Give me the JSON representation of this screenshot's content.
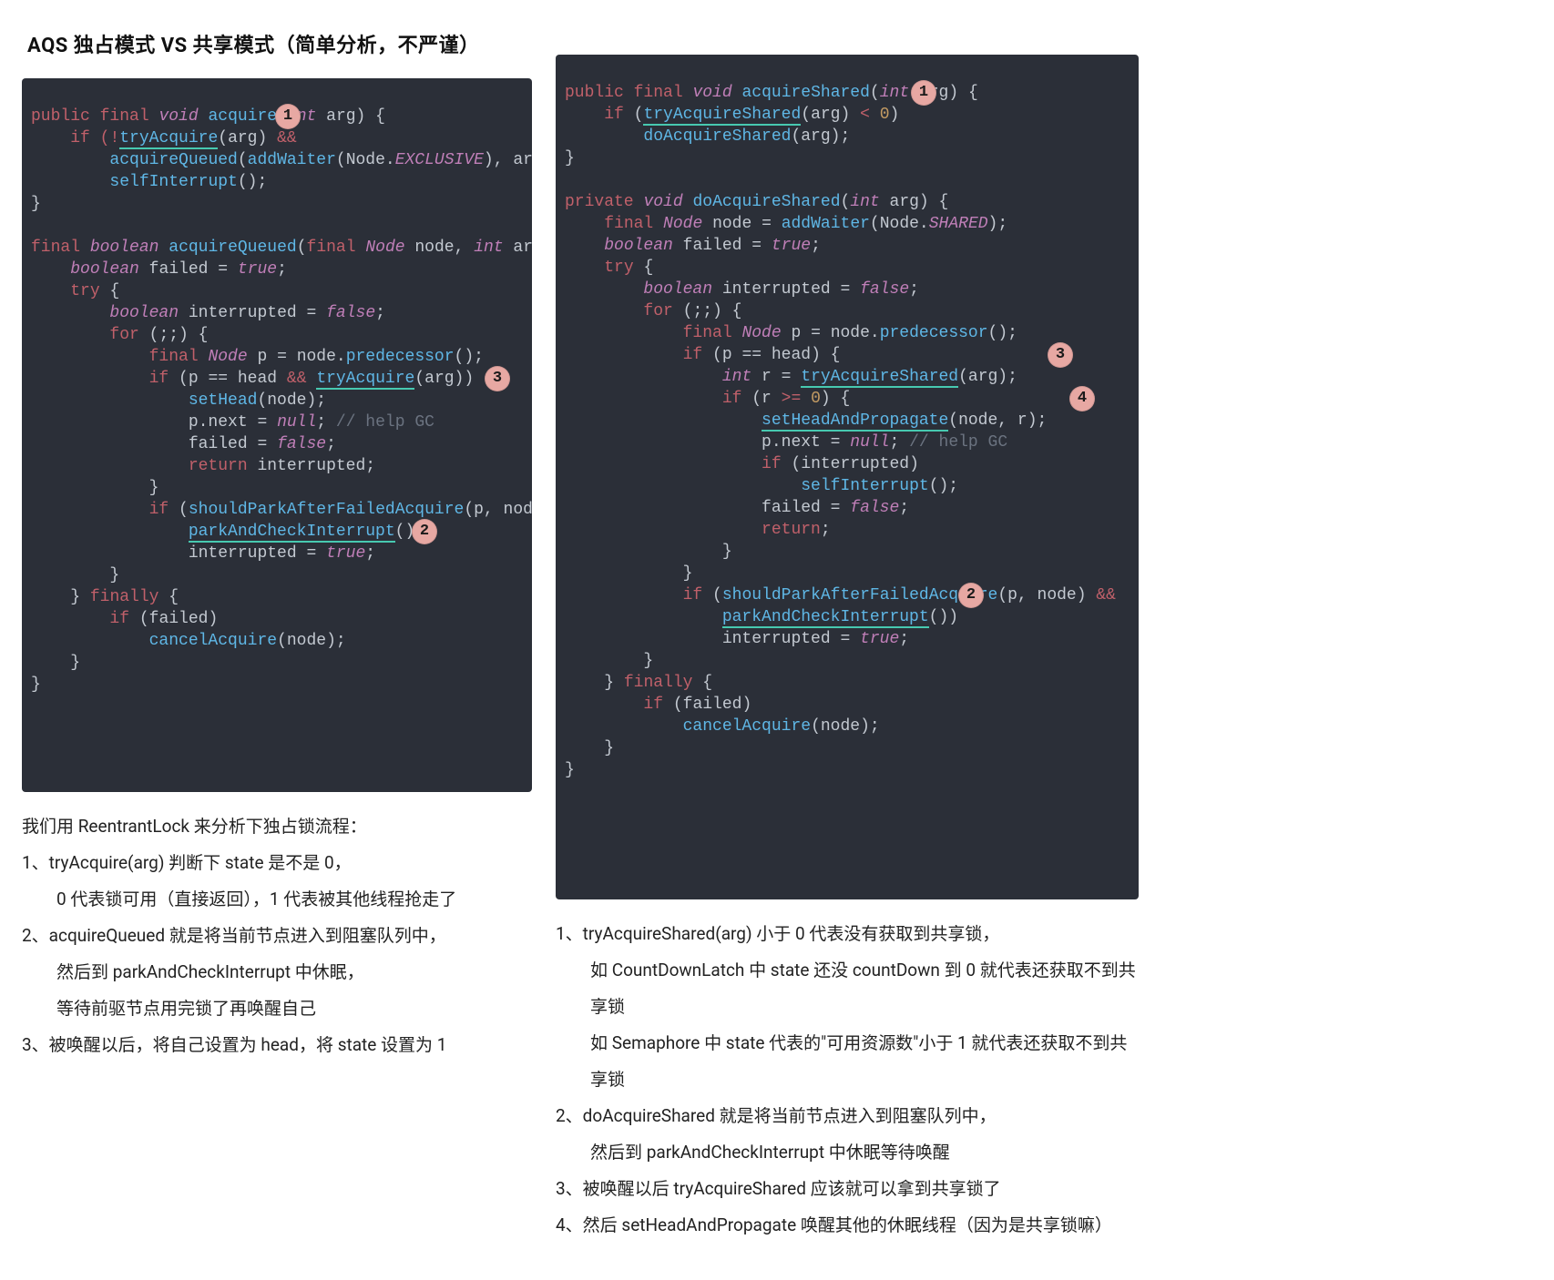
{
  "title": "AQS 独占模式 VS 共享模式（简单分析，不严谨）",
  "left": {
    "code": {
      "l01a": "public",
      "l01b": "final",
      "l01c": "void",
      "l01d": "acquire",
      "l01e": "int",
      "l01f": "arg",
      "l01g": ") {",
      "l02a": "if",
      "l02b": "(!",
      "l02c": "tryAcquire",
      "l02d": "(arg)",
      "l02e": "&&",
      "l03a": "acquireQueued",
      "l03b": "(",
      "l03c": "addWaiter",
      "l03d": "(Node.",
      "l03e": "EXCLUSIVE",
      "l03f": "), arg))",
      "l04a": "selfInterrupt",
      "l04b": "();",
      "l05a": "}",
      "l07a": "final",
      "l07b": "boolean",
      "l07c": "acquireQueued",
      "l07d": "(",
      "l07e": "final",
      "l07f": "Node",
      "l07g": "node,",
      "l07h": "int",
      "l07i": "arg) {",
      "l08a": "boolean",
      "l08b": "failed =",
      "l08c": "true",
      "l08d": ";",
      "l09a": "try",
      "l09b": "{",
      "l10a": "boolean",
      "l10b": "interrupted =",
      "l10c": "false",
      "l10d": ";",
      "l11a": "for",
      "l11b": "(;;) {",
      "l12a": "final",
      "l12b": "Node",
      "l12c": "p = node.",
      "l12d": "predecessor",
      "l12e": "();",
      "l13a": "if",
      "l13b": "(p == head",
      "l13c": "&&",
      "l13d": "tryAcquire",
      "l13e": "(arg)) {",
      "l14a": "setHead",
      "l14b": "(node);",
      "l15a": "p.next =",
      "l15b": "null",
      "l15c": ";",
      "l15d": "// help GC",
      "l16a": "failed =",
      "l16b": "false",
      "l16c": ";",
      "l17a": "return",
      "l17b": "interrupted;",
      "l18a": "}",
      "l19a": "if",
      "l19b": "(",
      "l19c": "shouldParkAfterFailedAcquire",
      "l19d": "(p, node)",
      "l19e": "&&",
      "l20a": "parkAndCheckInterrupt",
      "l20b": "())",
      "l21a": "interrupted =",
      "l21b": "true",
      "l21c": ";",
      "l22a": "}",
      "l23a": "}",
      "l23b": "finally",
      "l23c": "{",
      "l24a": "if",
      "l24b": "(failed)",
      "l25a": "cancelAcquire",
      "l25b": "(node);",
      "l26a": "}",
      "l27a": "}"
    },
    "badges": {
      "b1": "1",
      "b2": "2",
      "b3": "3"
    },
    "notes": [
      "我们用 ReentrantLock  来分析下独占锁流程：",
      "1、tryAcquire(arg) 判断下 state 是不是 0，",
      "0 代表锁可用（直接返回），1 代表被其他线程抢走了",
      "2、acquireQueued 就是将当前节点进入到阻塞队列中，",
      "然后到 parkAndCheckInterrupt 中休眠，",
      "等待前驱节点用完锁了再唤醒自己",
      "3、被唤醒以后，将自己设置为 head，将 state 设置为 1"
    ]
  },
  "right": {
    "code": {
      "l01a": "public",
      "l01b": "final",
      "l01c": "void",
      "l01d": "acquireShared",
      "l01e": "int",
      "l01f": "arg) {",
      "l02a": "if",
      "l02b": "(",
      "l02c": "tryAcquireShared",
      "l02d": "(arg)",
      "l02e": "<",
      "l02f": "0",
      "l02g": ")",
      "l03a": "doAcquireShared",
      "l03b": "(arg);",
      "l04a": "}",
      "l06a": "private",
      "l06b": "void",
      "l06c": "doAcquireShared",
      "l06d": "int",
      "l06e": "arg) {",
      "l07a": "final",
      "l07b": "Node",
      "l07c": "node =",
      "l07d": "addWaiter",
      "l07e": "(Node.",
      "l07f": "SHARED",
      "l07g": ");",
      "l08a": "boolean",
      "l08b": "failed =",
      "l08c": "true",
      "l08d": ";",
      "l09a": "try",
      "l09b": "{",
      "l10a": "boolean",
      "l10b": "interrupted =",
      "l10c": "false",
      "l10d": ";",
      "l11a": "for",
      "l11b": "(;;) {",
      "l12a": "final",
      "l12b": "Node",
      "l12c": "p = node.",
      "l12d": "predecessor",
      "l12e": "();",
      "l13a": "if",
      "l13b": "(p == head) {",
      "l14a": "int",
      "l14b": "r =",
      "l14c": "tryAcquireShared",
      "l14d": "(arg);",
      "l15a": "if",
      "l15b": "(r",
      "l15c": ">=",
      "l15d": "0",
      "l15e": ") {",
      "l16a": "setHeadAndPropagate",
      "l16b": "(node, r);",
      "l17a": "p.next =",
      "l17b": "null",
      "l17c": ";",
      "l17d": "// help GC",
      "l18a": "if",
      "l18b": "(interrupted)",
      "l19a": "selfInterrupt",
      "l19b": "();",
      "l20a": "failed =",
      "l20b": "false",
      "l20c": ";",
      "l21a": "return",
      "l21b": ";",
      "l22a": "}",
      "l23a": "}",
      "l24a": "if",
      "l24b": "(",
      "l24c": "shouldParkAfterFailedAcquire",
      "l24d": "(p, node)",
      "l24e": "&&",
      "l25a": "parkAndCheckInterrupt",
      "l25b": "())",
      "l26a": "interrupted =",
      "l26b": "true",
      "l26c": ";",
      "l27a": "}",
      "l28a": "}",
      "l28b": "finally",
      "l28c": "{",
      "l29a": "if",
      "l29b": "(failed)",
      "l30a": "cancelAcquire",
      "l30b": "(node);",
      "l31a": "}",
      "l32a": "}"
    },
    "badges": {
      "b1": "1",
      "b2": "2",
      "b3": "3",
      "b4": "4"
    },
    "notes": [
      "1、tryAcquireShared(arg) 小于 0 代表没有获取到共享锁，",
      "如 CountDownLatch 中 state 还没 countDown 到 0 就代表还获取不到共享锁",
      "如 Semaphore 中 state 代表的\"可用资源数\"小于 1 就代表还获取不到共享锁",
      "2、doAcquireShared 就是将当前节点进入到阻塞队列中，",
      "然后到 parkAndCheckInterrupt 中休眠等待唤醒",
      "3、被唤醒以后 tryAcquireShared 应该就可以拿到共享锁了",
      "4、然后 setHeadAndPropagate 唤醒其他的休眠线程（因为是共享锁嘛）"
    ]
  }
}
